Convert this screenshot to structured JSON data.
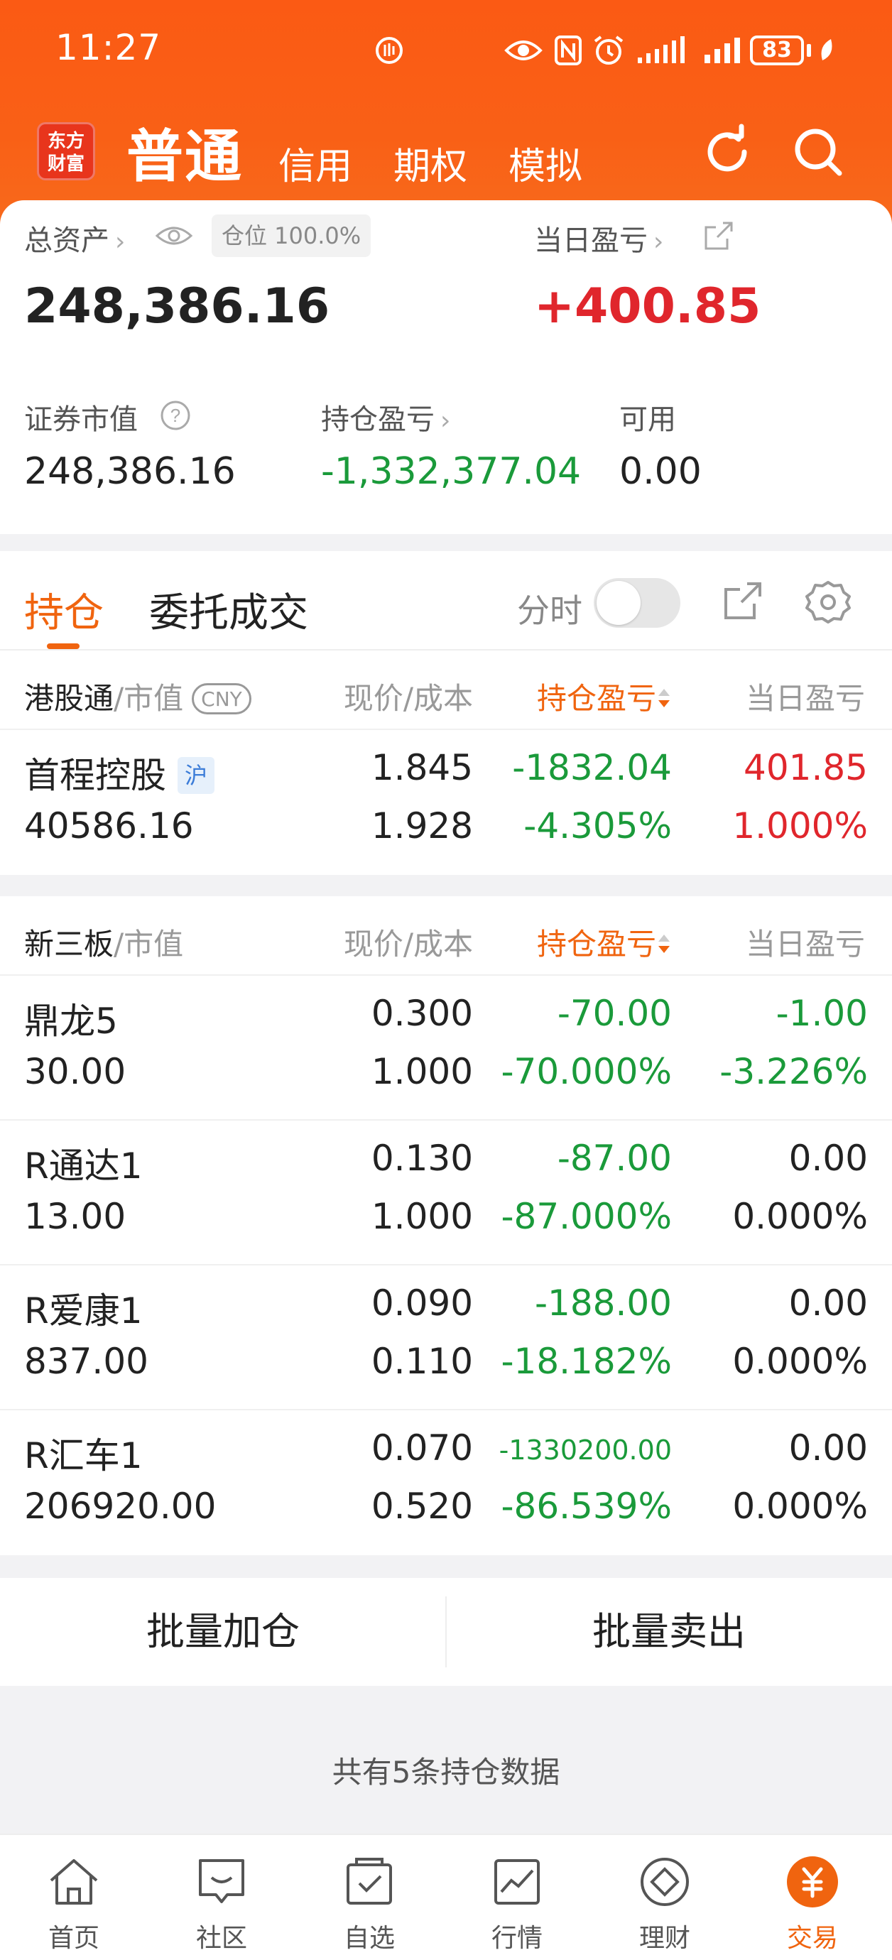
{
  "status_bar": {
    "time": "11:27",
    "battery": "83"
  },
  "nav": {
    "logo": "东方财富",
    "tabs": [
      "普通",
      "信用",
      "期权",
      "模拟"
    ]
  },
  "summary": {
    "total_assets_label": "总资产",
    "position_pill": "仓位 100.0%",
    "total_assets_value": "248,386.16",
    "daily_pl_label": "当日盈亏",
    "daily_pl_value": "+400.85",
    "market_value_label": "证券市值",
    "market_value": "248,386.16",
    "position_pl_label": "持仓盈亏",
    "position_pl_value": "-1,332,377.04",
    "available_label": "可用",
    "available_value": "0.00"
  },
  "tabs": {
    "holdings": "持仓",
    "orders": "委托成交",
    "timeshare_label": "分时"
  },
  "hk_section": {
    "title": "港股通",
    "title_suffix": "/市值",
    "currency": "CNY",
    "col_price": "现价/成本",
    "col_pl": "持仓盈亏",
    "col_daily": "当日盈亏",
    "rows": [
      {
        "name": "首程控股",
        "tag": "沪",
        "market_value": "40586.16",
        "price": "1.845",
        "cost": "1.928",
        "pl": "-1832.04",
        "pl_pct": "-4.305%",
        "daily": "401.85",
        "daily_pct": "1.000%"
      }
    ]
  },
  "neeq_section": {
    "title": "新三板",
    "title_suffix": "/市值",
    "col_price": "现价/成本",
    "col_pl": "持仓盈亏",
    "col_daily": "当日盈亏",
    "rows": [
      {
        "name": "鼎龙5",
        "market_value": "30.00",
        "price": "0.300",
        "cost": "1.000",
        "pl": "-70.00",
        "pl_pct": "-70.000%",
        "daily": "-1.00",
        "daily_pct": "-3.226%"
      },
      {
        "name": "R通达1",
        "market_value": "13.00",
        "price": "0.130",
        "cost": "1.000",
        "pl": "-87.00",
        "pl_pct": "-87.000%",
        "daily": "0.00",
        "daily_pct": "0.000%"
      },
      {
        "name": "R爱康1",
        "market_value": "837.00",
        "price": "0.090",
        "cost": "0.110",
        "pl": "-188.00",
        "pl_pct": "-18.182%",
        "daily": "0.00",
        "daily_pct": "0.000%"
      },
      {
        "name": "R汇车1",
        "market_value": "206920.00",
        "price": "0.070",
        "cost": "0.520",
        "pl": "-1330200.00",
        "pl_pct": "-86.539%",
        "daily": "0.00",
        "daily_pct": "0.000%"
      }
    ]
  },
  "actions": {
    "batch_add": "批量加仓",
    "batch_sell": "批量卖出"
  },
  "footer_count": "共有5条持仓数据",
  "tabbar": [
    "首页",
    "社区",
    "自选",
    "行情",
    "理财",
    "交易"
  ],
  "colors": {
    "accent": "#f0640f",
    "up": "#e0262c",
    "down": "#1a9a3a"
  }
}
